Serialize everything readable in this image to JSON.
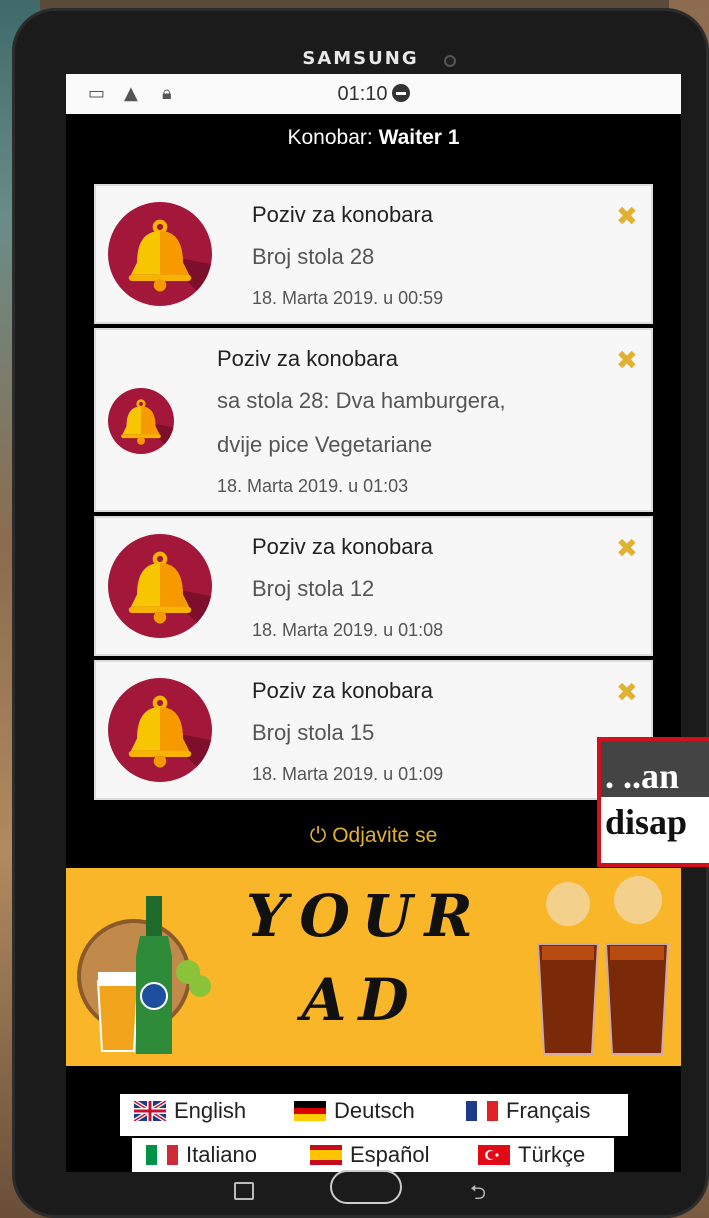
{
  "device": {
    "brand": "SAMSUNG"
  },
  "status_bar": {
    "time": "01:10"
  },
  "header": {
    "prefix": "Konobar: ",
    "waiter_name": "Waiter 1"
  },
  "notifications": [
    {
      "title": "Poziv za konobara",
      "lines": [
        "Broj stola 28"
      ],
      "date": "18. Marta 2019. u 00:59"
    },
    {
      "title": "Poziv za konobara",
      "lines": [
        "sa stola 28: Dva hamburgera,",
        "dvije pice Vegetariane"
      ],
      "date": "18. Marta 2019. u 01:03"
    },
    {
      "title": "Poziv za konobara",
      "lines": [
        "Broj stola 12"
      ],
      "date": "18. Marta 2019. u 01:08"
    },
    {
      "title": "Poziv za konobara",
      "lines": [
        "Broj stola 15"
      ],
      "date": "18. Marta 2019. u 01:09"
    }
  ],
  "close_glyph": "✖",
  "logout": {
    "label": "Odjavite se",
    "icon": "power-icon"
  },
  "ad": {
    "line1": "YOUR",
    "line2": "AD"
  },
  "languages": {
    "row1": [
      {
        "label": "English",
        "flag": "uk"
      },
      {
        "label": "Deutsch",
        "flag": "de"
      },
      {
        "label": "Français",
        "flag": "fr"
      }
    ],
    "row2": [
      {
        "label": "Italiano",
        "flag": "it"
      },
      {
        "label": "Español",
        "flag": "es"
      },
      {
        "label": "Türkçe",
        "flag": "tr"
      }
    ]
  },
  "overlay_caption": {
    "line1": ". ..an",
    "line2": "disap"
  },
  "colors": {
    "accent": "#e0b132",
    "bell_bg": "#a3173a",
    "ad_bg": "#f9b629",
    "caption_border": "#d0101a"
  }
}
